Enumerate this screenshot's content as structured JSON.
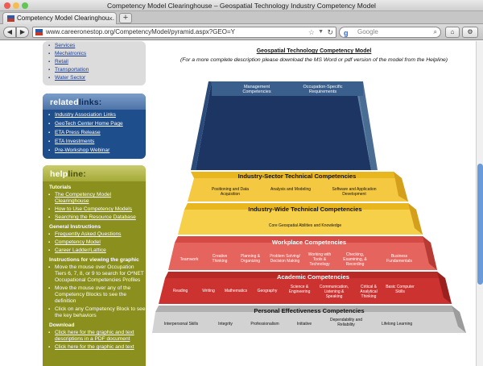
{
  "window": {
    "title": "Competency Model Clearinghouse – Geospatial Technology Industry Competency Model"
  },
  "tabs": [
    {
      "label": "Competency Model Clearinghou..."
    }
  ],
  "address_bar": {
    "url": "www.careeronestop.org/CompetencyModel/pyramid.aspx?GEO=Y"
  },
  "search_bar": {
    "placeholder": "Google"
  },
  "sidebar": {
    "top_links": [
      "Services",
      "Mechatronics",
      "Retail",
      "Transportation",
      "Water Sector"
    ],
    "related": {
      "heading_a": "related",
      "heading_b": "links:",
      "links": [
        "Industry Association Links",
        "GeoTech Center Home Page",
        "ETA Press Release",
        "ETA Investments",
        "Pre-Workshop Webinar"
      ]
    },
    "help": {
      "heading_a": "help",
      "heading_b": "line:",
      "tutorials_label": "Tutorials",
      "tutorials": [
        "The Competency Model Clearinghouse",
        "How to Use Competency Models",
        "Searching the Resource Database"
      ],
      "general_label": "General Instructions",
      "general": [
        "Frequently Asked Questions",
        "Competency Model",
        "Career Ladder/Lattice"
      ],
      "graphic_label": "Instructions for viewing the graphic",
      "graphic": [
        "Move the mouse over Occupation Tiers 6, 7, 8, or 9 to search for O*NET Occupational Competencies Profiles",
        "Move the mouse over any of the Competency Blocks to see the definition",
        "Click on any Competency Block to see the key behaviors"
      ],
      "download_label": "Download",
      "download": [
        "Click here for the graphic and text descriptions in a PDF document",
        "Click here for the graphic and text"
      ]
    }
  },
  "main": {
    "title": "Geospatial Technology Competency Model",
    "subtitle": "(For a more complete description please download the MS Word or pdf version of the model from the Helpline)",
    "top_blocks": [
      "Management Competencies",
      "Occupation-Specific Requirements"
    ],
    "tiers": [
      {
        "title": "Industry-Sector Technical Competencies",
        "blocks": [
          "Positioning and Data Acquisition",
          "Analysis and Modeling",
          "Software and Application Development"
        ]
      },
      {
        "title": "Industry-Wide Technical Competencies",
        "blocks": [
          "Core Geospatial Abilities and Knowledge"
        ]
      },
      {
        "title": "Workplace Competencies",
        "blocks": [
          "Teamwork",
          "Creative Thinking",
          "Planning & Organizing",
          "Problem Solving/ Decision Making",
          "Working with Tools & Technology",
          "Checking, Examining, & Recording",
          "Business Fundamentals"
        ]
      },
      {
        "title": "Academic Competencies",
        "blocks": [
          "Reading",
          "Writing",
          "Mathematics",
          "Geography",
          "Science & Engineering",
          "Communication, Listening & Speaking",
          "Critical & Analytical Thinking",
          "Basic Computer Skills"
        ]
      },
      {
        "title": "Personal Effectiveness Competencies",
        "blocks": [
          "Interpersonal Skills",
          "Integrity",
          "Professionalism",
          "Initiative",
          "Dependability and Reliability",
          "Lifelong Learning"
        ]
      }
    ]
  },
  "colors": {
    "top_dark": "#1d3563",
    "top_light": "#5b7fa5",
    "sector": "#f1c232",
    "wide": "#f4cc38",
    "workplace": "#e05a55",
    "academic": "#c9302c",
    "personal": "#c3c3c3"
  }
}
